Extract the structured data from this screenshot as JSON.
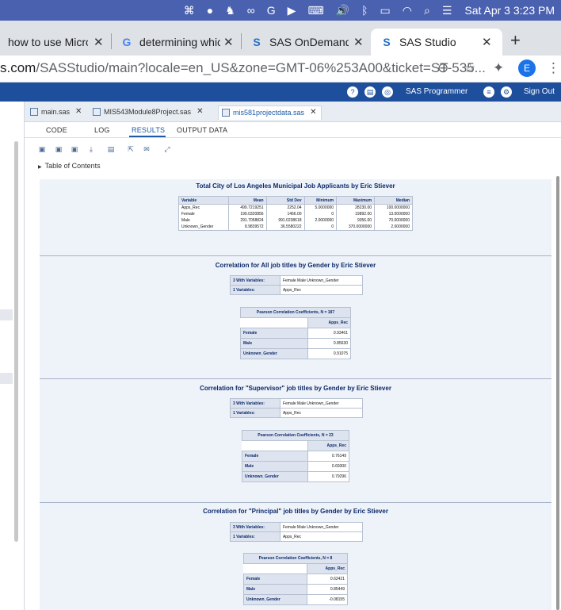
{
  "menubar": {
    "icons": [
      "app-badge-icon",
      "record-icon",
      "elephant-icon",
      "creative-cloud-icon",
      "grammarly-icon",
      "play-icon",
      "keyboard-icon",
      "volume-icon",
      "bluetooth-icon",
      "battery-icon",
      "wifi-icon",
      "search-icon",
      "control-center-icon"
    ],
    "clock": "Sat Apr 3  3:23 PM"
  },
  "browser": {
    "tabs": [
      {
        "label": "how to use Micros",
        "favicon": "microsoft"
      },
      {
        "label": "determining whicl",
        "favicon": "G"
      },
      {
        "label": "SAS OnDemand f",
        "favicon": "S"
      },
      {
        "label": "SAS Studio",
        "favicon": "S"
      }
    ],
    "url_domain": "s.com",
    "url_path": "/SASStudio/main?locale=en_US&zone=GMT-06%253A00&ticket=ST-535...",
    "profile_initial": "E"
  },
  "sas": {
    "user_menu": "SAS Programmer",
    "sign_out": "Sign Out",
    "editor_tabs": [
      {
        "label": "main.sas"
      },
      {
        "label": "MIS543Module8Project.sas"
      },
      {
        "label": "mis581projectdata.sas"
      }
    ],
    "subtabs": [
      "CODE",
      "LOG",
      "RESULTS",
      "OUTPUT DATA"
    ],
    "toc_label": "Table of Contents"
  },
  "results": {
    "summary": {
      "title": "Total City of Los Angeles Municipal Job Applicants by Eric Stiever",
      "headers": [
        "Variable",
        "Mean",
        "Std Dev",
        "Minimum",
        "Maximum",
        "Median"
      ],
      "rows": [
        [
          "Apps_Rec",
          "499.7219251",
          "2252.04",
          "5.0000000",
          "28230.00",
          "100.0000000"
        ],
        [
          "Female",
          "199.0320856",
          "1466.00",
          "0",
          "19892.00",
          "13.0000000"
        ],
        [
          "Male",
          "291.7058824",
          "991.0238618",
          "2.0000000",
          "9356.00",
          "70.0000000"
        ],
        [
          "Unknown_Gender",
          "8.9839572",
          "36.5580222",
          "0",
          "370.0000000",
          "2.0000000"
        ]
      ]
    },
    "correlations": [
      {
        "title": "Correlation for All job titles by Gender by Eric Stiever",
        "with_label": "3 With Variables:",
        "with_value": "Female Male Unknown_Gender",
        "var_label": "1 Variables:",
        "var_value": "Apps_Rec",
        "pearson_header": "Pearson Correlation Coefficients, N = 187",
        "col_header": "Apps_Rec",
        "rows": [
          [
            "Female",
            "0.93461"
          ],
          [
            "Male",
            "0.85630"
          ],
          [
            "Unknown_Gender",
            "0.91075"
          ]
        ]
      },
      {
        "title": "Correlation for \"Supervisor\" job titles by Gender by Eric Stiever",
        "with_label": "3 With Variables:",
        "with_value": "Female Male Unknown_Gender",
        "var_label": "1 Variables:",
        "var_value": "Apps_Rec",
        "pearson_header": "Pearson Correlation Coefficients, N = 23",
        "col_header": "Apps_Rec",
        "rows": [
          [
            "Female",
            "0.76149"
          ],
          [
            "Male",
            "0.69300"
          ],
          [
            "Unknown_Gender",
            "0.79296"
          ]
        ]
      },
      {
        "title": "Correlation for \"Principal\" job titles by Gender by Eric Stiever",
        "with_label": "3 With Variables:",
        "with_value": "Female Male Unknown_Gender",
        "var_label": "1 Variables:",
        "var_value": "Apps_Rec",
        "pearson_header": "Pearson Correlation Coefficients, N = 8",
        "col_header": "Apps_Rec",
        "rows": [
          [
            "Female",
            "0.62421"
          ],
          [
            "Male",
            "0.85449"
          ],
          [
            "Unknown_Gender",
            "-0.08155"
          ]
        ]
      }
    ]
  }
}
